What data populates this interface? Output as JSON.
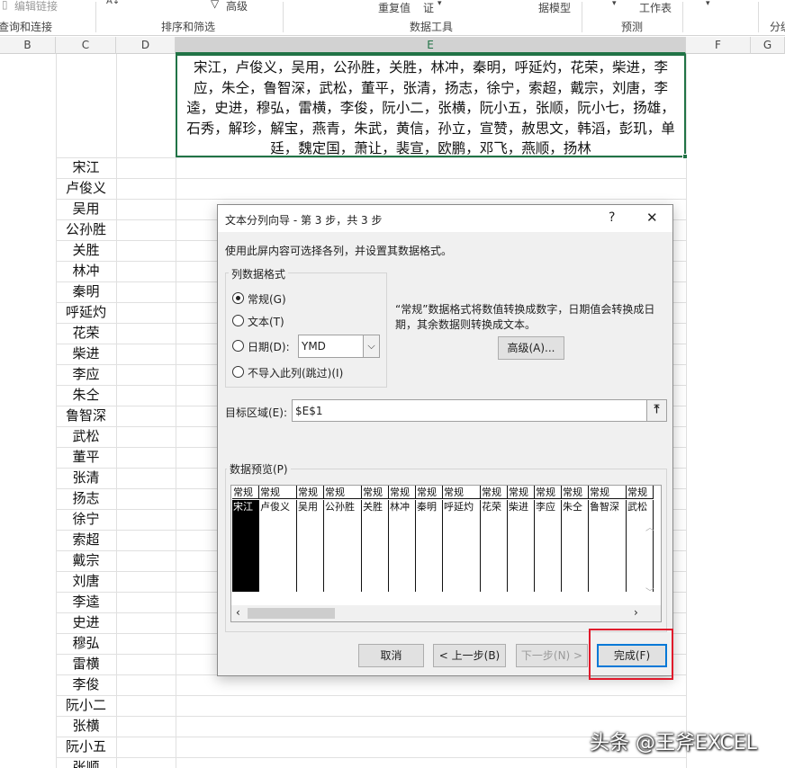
{
  "ribbon": {
    "edit_links": "编辑链接",
    "advanced": "高级",
    "duplicates": "重复值",
    "verify": "证",
    "data_model": "据模型",
    "worksheet": "工作表",
    "group_query": "查询和连接",
    "group_sort": "排序和筛选",
    "group_tools": "数据工具",
    "group_forecast": "预测",
    "group_outline": "分级"
  },
  "columns": [
    "B",
    "C",
    "D",
    "E",
    "F",
    "G"
  ],
  "cell_e1": "宋江，卢俊义，吴用，公孙胜，关胜，林冲，秦明，呼延灼，花荣，柴进，李应，朱仝，鲁智深，武松，董平，张清，扬志，徐宁，索超，戴宗，刘唐，李逵，史进，穆弘，雷横，李俊，阮小二，张横，阮小五，张顺，阮小七，扬雄，石秀，解珍，解宝，燕青，朱武，黄信，孙立，宣赞，赦思文，韩滔，彭玑，单廷，魏定国，萧让，裴宣，欧鹏，邓飞，燕顺，扬林",
  "names": [
    "宋江",
    "卢俊义",
    "吴用",
    "公孙胜",
    "关胜",
    "林冲",
    "秦明",
    "呼延灼",
    "花荣",
    "柴进",
    "李应",
    "朱仝",
    "鲁智深",
    "武松",
    "董平",
    "张清",
    "扬志",
    "徐宁",
    "索超",
    "戴宗",
    "刘唐",
    "李逵",
    "史进",
    "穆弘",
    "雷横",
    "李俊",
    "阮小二",
    "张横",
    "阮小五",
    "张顺"
  ],
  "dialog": {
    "title": "文本分列向导 - 第 3 步，共 3 步",
    "help": "?",
    "close": "✕",
    "instruction": "使用此屏内容可选择各列，并设置其数据格式。",
    "format_group": "列数据格式",
    "radio_general": "常规(G)",
    "radio_text": "文本(T)",
    "radio_date": "日期(D):",
    "radio_skip": "不导入此列(跳过)(I)",
    "date_value": "YMD",
    "description": "“常规”数据格式将数值转换成数字，日期值会转换成日期，其余数据则转换成文本。",
    "advanced_button": "高级(A)...",
    "target_label": "目标区域(E):",
    "target_value": "$E$1",
    "preview_label": "数据预览(P)",
    "preview_headers": [
      "常规",
      "常规",
      "常规",
      "常规",
      "常规",
      "常规",
      "常规",
      "常规",
      "常规",
      "常规",
      "常规",
      "常规",
      "常规",
      "常规"
    ],
    "preview_values": [
      "宋江",
      "卢俊义",
      "吴用",
      "公孙胜",
      "关胜",
      "林冲",
      "秦明",
      "呼延灼",
      "花荣",
      "柴进",
      "李应",
      "朱仝",
      "鲁智深",
      "武松"
    ],
    "cancel": "取消",
    "back": "< 上一步(B)",
    "next": "下一步(N) >",
    "finish": "完成(F)"
  },
  "watermark": "头条 @王斧EXCEL",
  "colors": {
    "excel_green": "#217346",
    "highlight_red": "#e0192b",
    "focus_blue": "#0078d7"
  }
}
